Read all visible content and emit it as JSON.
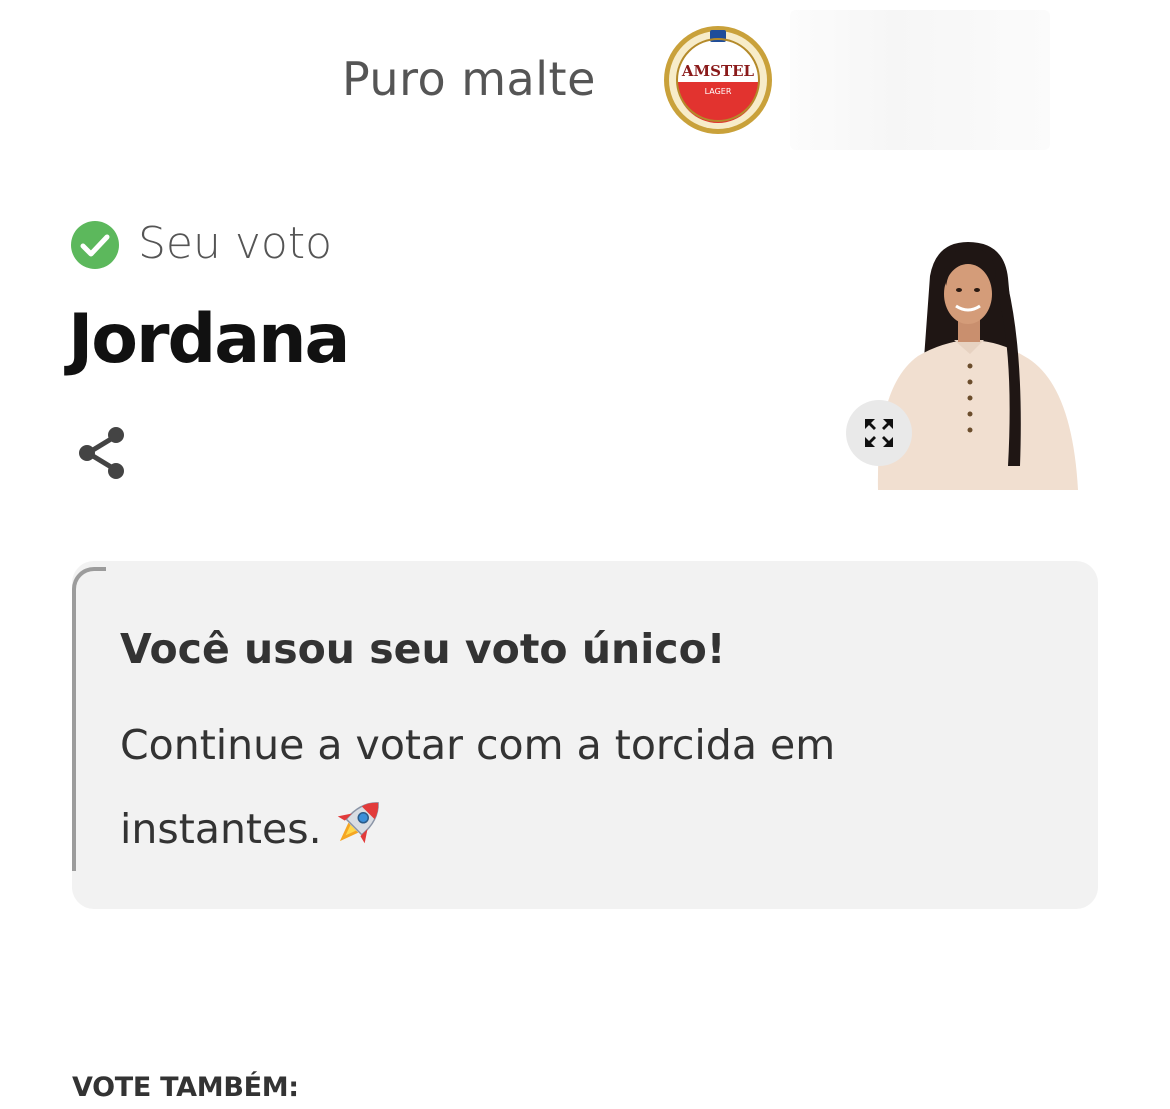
{
  "sponsor": {
    "tagline": "Puro malte",
    "logo_icon": "amstel-lager-logo",
    "logo_text_top": "AMSTEL",
    "logo_text_bottom": "LAGER"
  },
  "vote": {
    "status_icon": "check-circle-icon",
    "status_color": "#5cb85c",
    "label": "Seu voto",
    "candidate_name": "Jordana",
    "share_icon": "share-icon",
    "expand_icon": "expand-icon"
  },
  "info_card": {
    "title": "Você usou seu voto único!",
    "body": "Continue a votar com a torcida em instantes.",
    "icon": "rocket-icon"
  },
  "also_vote": {
    "heading": "VOTE TAMBÉM:"
  }
}
